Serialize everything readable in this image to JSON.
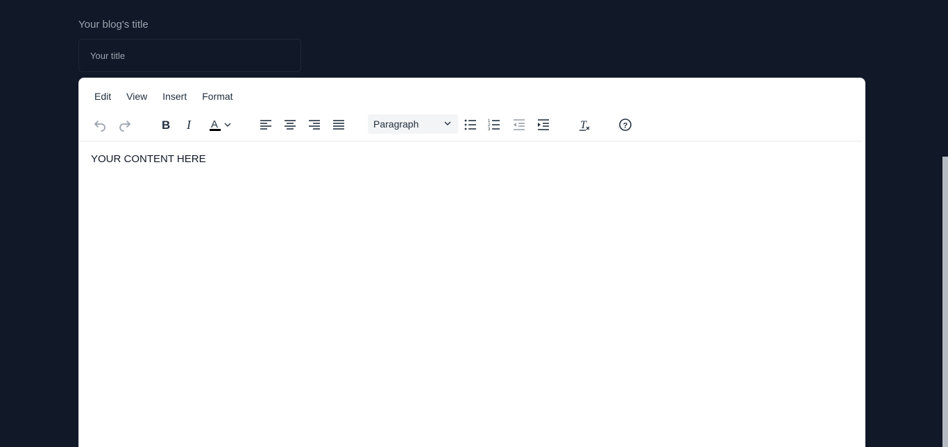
{
  "form": {
    "title_label": "Your blog's title",
    "title_placeholder": "Your title",
    "title_value": ""
  },
  "editor": {
    "menu": [
      "Edit",
      "View",
      "Insert",
      "Format"
    ],
    "toolbar": {
      "block_format": "Paragraph",
      "buttons": [
        "undo-icon",
        "redo-icon",
        "bold-icon",
        "italic-icon",
        "text-color-icon",
        "align-left-icon",
        "align-center-icon",
        "align-right-icon",
        "align-justify-icon",
        "bullet-list-icon",
        "numbered-list-icon",
        "outdent-icon",
        "indent-icon",
        "clear-formatting-icon",
        "help-icon"
      ],
      "text_color": "#000000"
    },
    "content": "YOUR CONTENT HERE"
  },
  "colors": {
    "page_background": "#111827",
    "editor_background": "#ffffff",
    "label_text": "#9ca3af"
  }
}
